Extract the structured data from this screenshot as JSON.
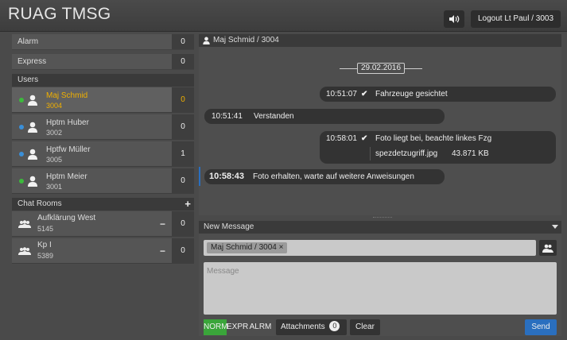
{
  "app": {
    "title": "RUAG TMSG"
  },
  "header": {
    "sound_icon": "speaker-icon",
    "logout_label": "Logout Lt Paul / 3003"
  },
  "sidebar": {
    "alarm": {
      "label": "Alarm",
      "count": "0"
    },
    "express": {
      "label": "Express",
      "count": "0"
    },
    "users_title": "Users",
    "users": [
      {
        "name": "Maj Schmid",
        "id": "3004",
        "count": "0",
        "status_color": "#3cba3c",
        "selected": true
      },
      {
        "name": "Hptm Huber",
        "id": "3002",
        "count": "0",
        "status_color": "#3a8fd8",
        "selected": false
      },
      {
        "name": "Hptfw Müller",
        "id": "3005",
        "count": "1",
        "status_color": "#3a8fd8",
        "selected": false
      },
      {
        "name": "Hptm Meier",
        "id": "3001",
        "count": "0",
        "status_color": "#3cba3c",
        "selected": false
      }
    ],
    "chatrooms_title": "Chat Rooms",
    "chatrooms_add": "+",
    "chatrooms": [
      {
        "name": "Aufklärung West",
        "id": "5145",
        "remove": "−",
        "count": "0"
      },
      {
        "name": "Kp I",
        "id": "5389",
        "remove": "−",
        "count": "0"
      }
    ]
  },
  "chat": {
    "title": "Maj Schmid / 3004",
    "date": "29.02.2016",
    "messages": [
      {
        "time": "10:51:07",
        "text": "Fahrzeuge gesichtet",
        "outgoing": true
      },
      {
        "time": "10:51:41",
        "text": "Verstanden",
        "outgoing": false
      },
      {
        "time": "10:58:01",
        "text": "Foto liegt bei, beachte linkes Fzg",
        "outgoing": true,
        "attachment": {
          "file": "spezdetzugriff.jpg",
          "size": "43.871 KB"
        }
      },
      {
        "time": "10:58:43",
        "text": "Foto erhalten, warte auf weitere Anweisungen",
        "outgoing": false
      }
    ]
  },
  "new_message": {
    "title": "New Message",
    "recipient": "Maj Schmid / 3004 ×",
    "placeholder": "Message",
    "buttons": {
      "norm": "NORM",
      "expr": "EXPR",
      "alrm": "ALRM",
      "attachments": "Attachments",
      "attachments_count": "0",
      "clear": "Clear",
      "send": "Send"
    }
  },
  "colors": {
    "selected_user": "#f0b000",
    "norm_active": "#3aa53a",
    "send": "#2a6fbf"
  }
}
